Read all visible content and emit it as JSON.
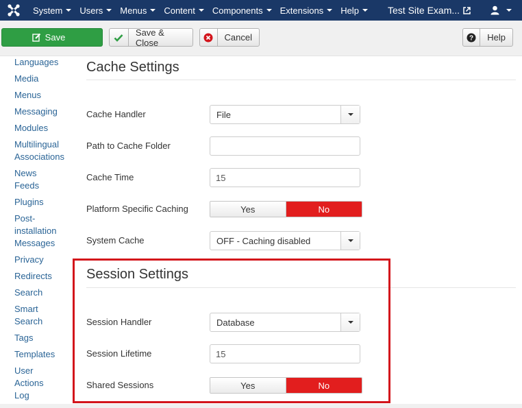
{
  "navbar": {
    "logo_icon": "joomla-logo-icon",
    "menu": [
      "System",
      "Users",
      "Menus",
      "Content",
      "Components",
      "Extensions",
      "Help"
    ],
    "site_title": "Test Site Exam...",
    "site_title_icon": "external-link-icon",
    "user_icon": "user-icon"
  },
  "toolbar": {
    "save_label": "Save",
    "save_close_label": "Save & Close",
    "cancel_label": "Cancel",
    "help_label": "Help"
  },
  "sidebar": {
    "items": [
      [
        "Languages"
      ],
      [
        "Media"
      ],
      [
        "Menus"
      ],
      [
        "Messaging"
      ],
      [
        "Modules"
      ],
      [
        "Multilingual",
        "Associations"
      ],
      [
        "News",
        "Feeds"
      ],
      [
        "Plugins"
      ],
      [
        "Post-",
        "installation",
        "Messages"
      ],
      [
        "Privacy"
      ],
      [
        "Redirects"
      ],
      [
        "Search"
      ],
      [
        "Smart",
        "Search"
      ],
      [
        "Tags"
      ],
      [
        "Templates"
      ],
      [
        "User",
        "Actions",
        "Log"
      ]
    ]
  },
  "cache": {
    "title": "Cache Settings",
    "handler_label": "Cache Handler",
    "handler_value": "File",
    "path_label": "Path to Cache Folder",
    "path_value": "",
    "time_label": "Cache Time",
    "time_value": "15",
    "platform_label": "Platform Specific Caching",
    "platform_yes": "Yes",
    "platform_no": "No",
    "platform_selected": "No",
    "system_label": "System Cache",
    "system_value": "OFF - Caching disabled"
  },
  "session": {
    "title": "Session Settings",
    "handler_label": "Session Handler",
    "handler_value": "Database",
    "lifetime_label": "Session Lifetime",
    "lifetime_value": "15",
    "shared_label": "Shared Sessions",
    "shared_yes": "Yes",
    "shared_no": "No",
    "shared_selected": "No"
  },
  "colors": {
    "navbar": "#1a3867",
    "save_button": "#2f9e44",
    "toggle_active": "#e21e1e",
    "highlight_border": "#d3141b",
    "link": "#2a6496"
  }
}
